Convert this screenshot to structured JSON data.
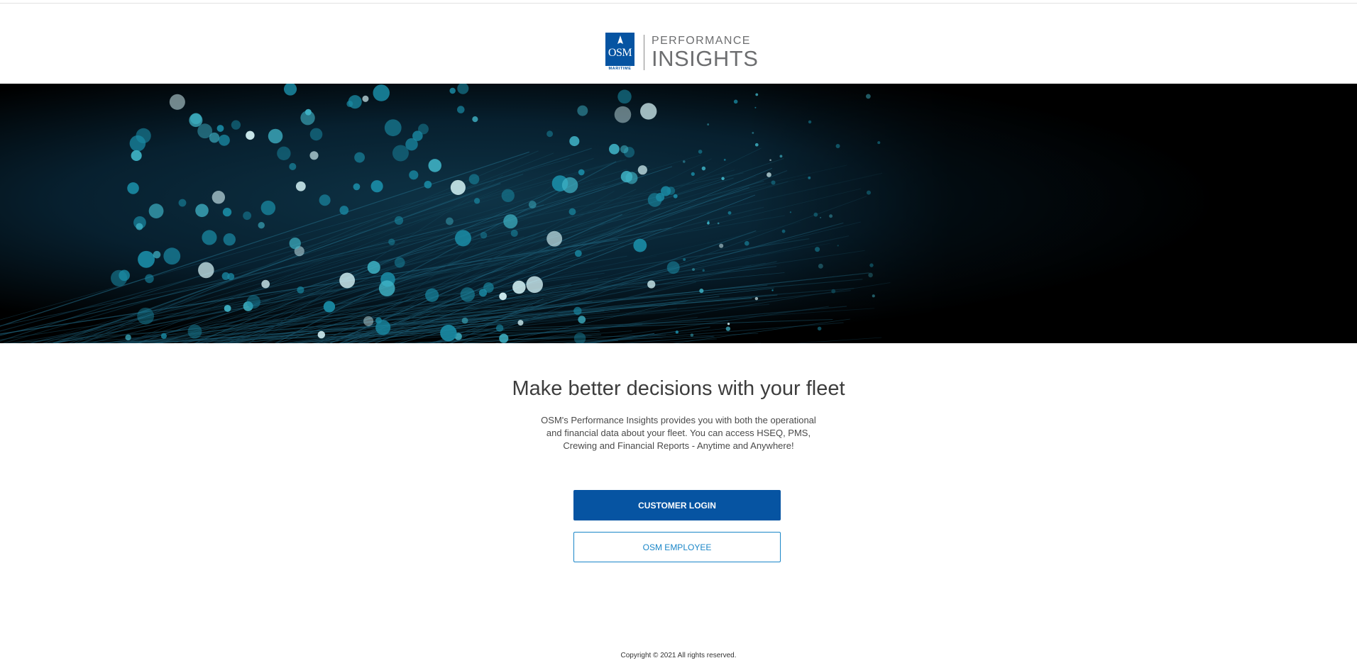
{
  "header": {
    "logo": {
      "badge_text": "OSM",
      "badge_sub": "MARITIME",
      "line1": "PERFORMANCE",
      "line2": "INSIGHTS"
    }
  },
  "hero": {
    "image": "fiber-optic-light-bokeh"
  },
  "main": {
    "headline": "Make better decisions with your fleet",
    "description": "OSM's Performance Insights provides you with both the operational and financial data about your fleet. You can access HSEQ, PMS, Crewing and Financial Reports - Anytime and Anywhere!",
    "customer_login_label": "CUSTOMER LOGIN",
    "employee_label": "OSM EMPLOYEE"
  },
  "footer": {
    "copyright": "Copyright © 2021 All rights reserved."
  },
  "colors": {
    "brand_blue": "#0654a2",
    "outline_blue": "#1a86c8",
    "headline": "#3d3d3d",
    "logo_gray": "#6d6e70"
  }
}
